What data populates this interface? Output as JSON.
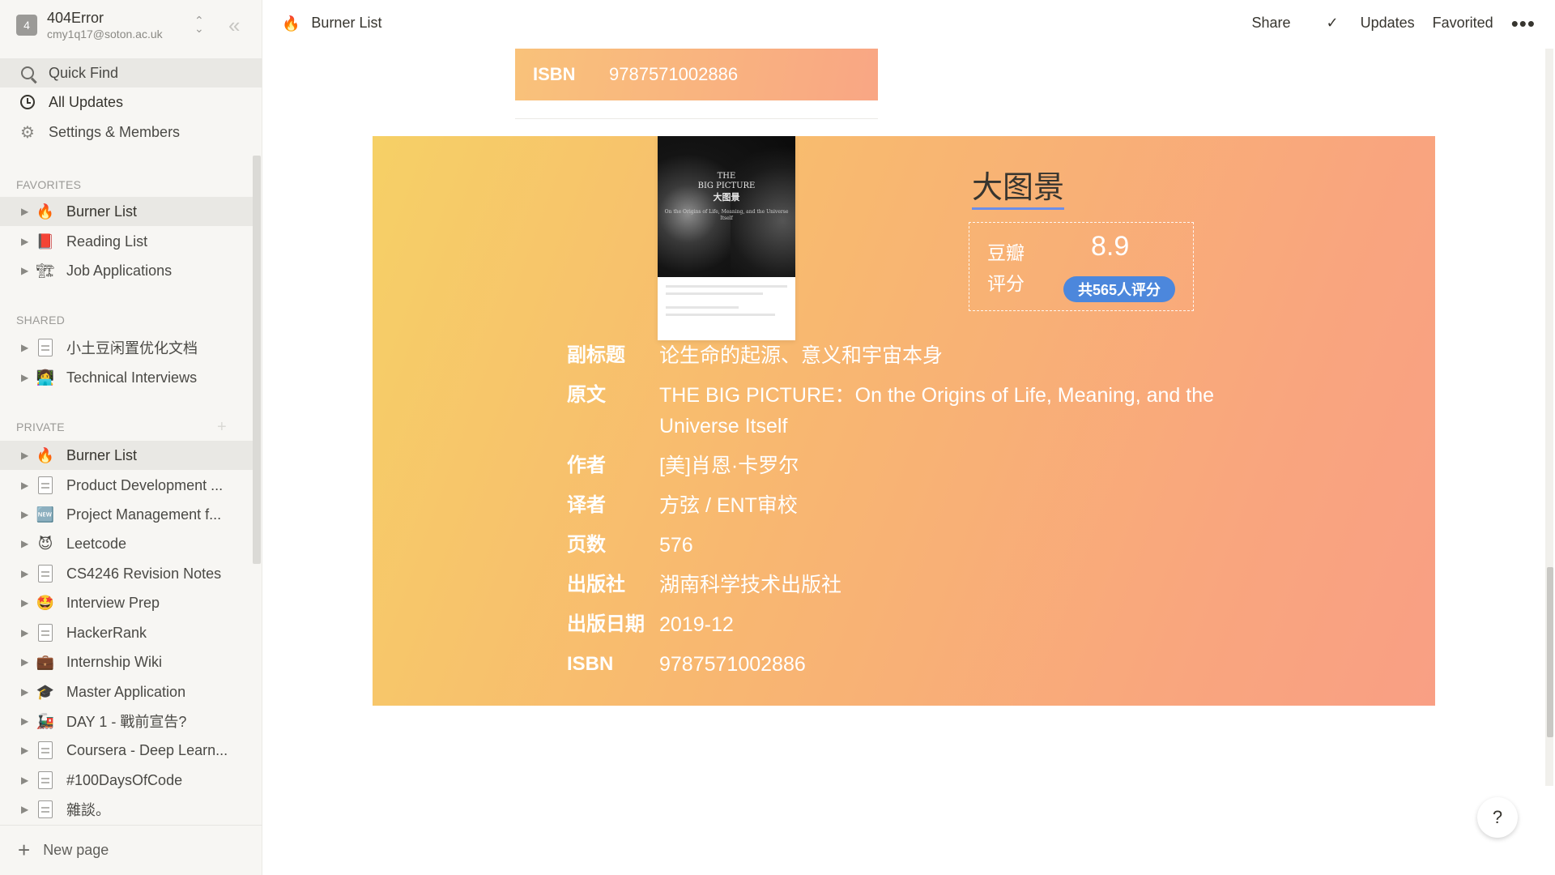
{
  "workspace": {
    "badge": "4",
    "name": "404Error",
    "email": "cmy1q17@soton.ac.uk"
  },
  "menu": {
    "quick_find": "Quick Find",
    "all_updates": "All Updates",
    "settings": "Settings & Members"
  },
  "sections": {
    "favorites": "FAVORITES",
    "shared": "SHARED",
    "private": "PRIVATE"
  },
  "favorites": [
    {
      "icon": "🔥",
      "label": "Burner List"
    },
    {
      "icon": "📕",
      "label": "Reading List"
    },
    {
      "icon": "🏗",
      "label": "Job Applications"
    }
  ],
  "shared": [
    {
      "icon": "doc",
      "label": "小土豆闲置优化文档"
    },
    {
      "icon": "👩‍💻",
      "label": "Technical Interviews"
    }
  ],
  "private": [
    {
      "icon": "🔥",
      "label": "Burner List"
    },
    {
      "icon": "doc",
      "label": "Product Development ..."
    },
    {
      "icon": "🆕",
      "label": "Project Management f..."
    },
    {
      "icon": "😈",
      "label": "Leetcode"
    },
    {
      "icon": "doc",
      "label": "CS4246 Revision Notes"
    },
    {
      "icon": "🤩",
      "label": "Interview Prep"
    },
    {
      "icon": "doc",
      "label": "HackerRank"
    },
    {
      "icon": "💼",
      "label": "Internship Wiki"
    },
    {
      "icon": "🎓",
      "label": "Master Application"
    },
    {
      "icon": "🚂",
      "label": "DAY 1 - 戰前宣告?"
    },
    {
      "icon": "doc",
      "label": "Coursera - Deep Learn..."
    },
    {
      "icon": "doc",
      "label": "#100DaysOfCode"
    },
    {
      "icon": "doc",
      "label": "雜談。"
    }
  ],
  "new_page": "New page",
  "topbar": {
    "icon": "🔥",
    "title": "Burner List",
    "share": "Share",
    "updates": "Updates",
    "favorited": "Favorited",
    "more": "•••"
  },
  "prev_card": {
    "label": "ISBN",
    "value": "9787571002886"
  },
  "book": {
    "title": "大图景",
    "cover": {
      "en_title_1": "THE",
      "en_title_2": "BIG PICTURE",
      "cn_title": "大图景",
      "subtitle": "On the Origins of Life, Meaning, and the Universe Itself"
    },
    "rating_label_1": "豆瓣",
    "rating_label_2": "评分",
    "score": "8.9",
    "rating_count": "共565人评分",
    "fields": [
      {
        "label": "副标题",
        "value": "论生命的起源、意义和宇宙本身"
      },
      {
        "label": "原文",
        "value": "THE BIG PICTURE：On the Origins of Life, Meaning, and the Universe Itself"
      },
      {
        "label": "作者",
        "value": "[美]肖恩·卡罗尔"
      },
      {
        "label": "译者",
        "value": "方弦 / ENT审校"
      },
      {
        "label": "页数",
        "value": "576"
      },
      {
        "label": "出版社",
        "value": "湖南科学技术出版社"
      },
      {
        "label": "出版日期",
        "value": "2019-12"
      },
      {
        "label": "ISBN",
        "value": "9787571002886"
      }
    ]
  },
  "help": "?"
}
